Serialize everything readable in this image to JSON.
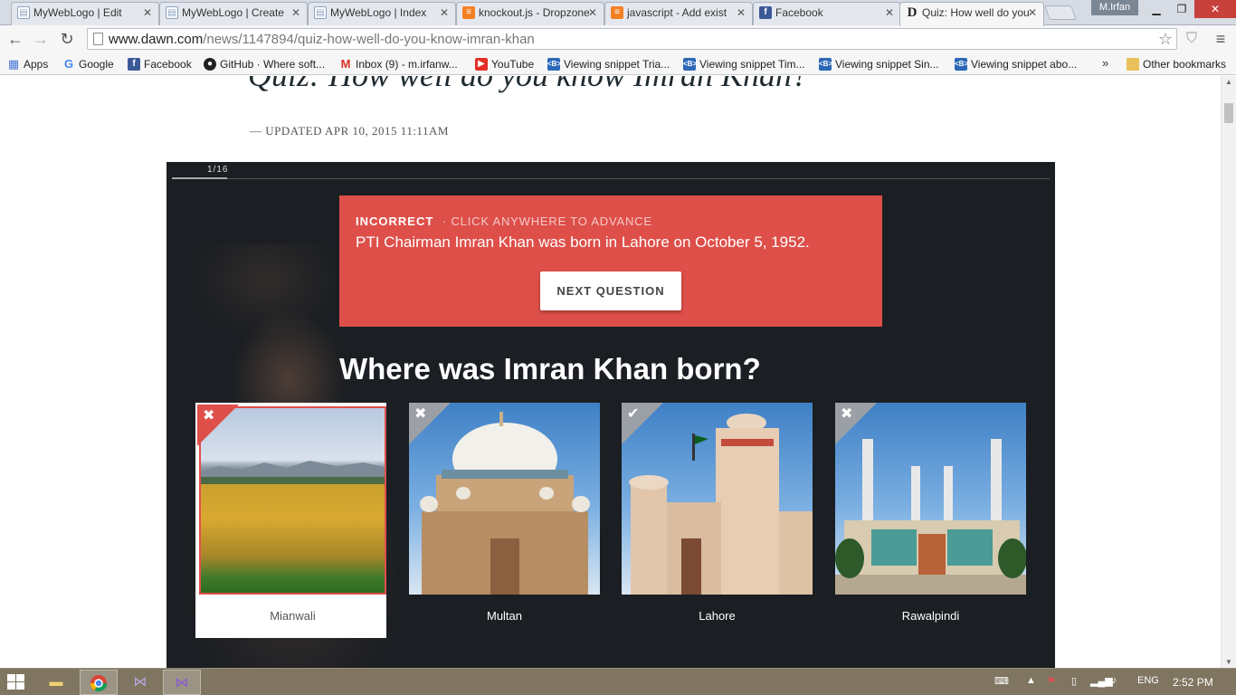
{
  "browser": {
    "tabs": [
      {
        "title": "MyWebLogo | Edit",
        "icon": "document-icon"
      },
      {
        "title": "MyWebLogo | Create",
        "icon": "document-icon"
      },
      {
        "title": "MyWebLogo | Index",
        "icon": "document-icon"
      },
      {
        "title": "knockout.js - Dropzone",
        "icon": "stackoverflow-icon"
      },
      {
        "title": "javascript - Add exist",
        "icon": "stackoverflow-icon"
      },
      {
        "title": "Facebook",
        "icon": "facebook-icon"
      },
      {
        "title": "Quiz: How well do you",
        "icon": "dawn-icon",
        "active": true
      }
    ],
    "profile_name": "M.Irfan",
    "url_host": "www.dawn.com",
    "url_path": "/news/1147894/quiz-how-well-do-you-know-imran-khan",
    "bookmarks": [
      {
        "label": "Apps",
        "icon": "apps-icon"
      },
      {
        "label": "Google",
        "icon": "google-icon"
      },
      {
        "label": "Facebook",
        "icon": "facebook-icon"
      },
      {
        "label": "GitHub · Where soft...",
        "icon": "github-icon"
      },
      {
        "label": "Inbox (9) - m.irfanw...",
        "icon": "gmail-icon"
      },
      {
        "label": "YouTube",
        "icon": "youtube-icon"
      },
      {
        "label": "Viewing snippet Tria...",
        "icon": "snippet-icon"
      },
      {
        "label": "Viewing snippet Tim...",
        "icon": "snippet-icon"
      },
      {
        "label": "Viewing snippet Sin...",
        "icon": "snippet-icon"
      },
      {
        "label": "Viewing snippet abo...",
        "icon": "snippet-icon"
      }
    ],
    "bookmarks_more": "»",
    "other_bookmarks": "Other bookmarks"
  },
  "article": {
    "title": "Quiz: How well do you know Imran Khan?",
    "updated": "— UPDATED APR 10, 2015 11:11AM"
  },
  "quiz": {
    "progress_label": "1/16",
    "progress_fraction": 0.0625,
    "feedback": {
      "status": "INCORRECT",
      "hint": "· CLICK ANYWHERE TO ADVANCE",
      "message": "PTI Chairman Imran Khan was born in Lahore on October 5, 1952.",
      "next_button": "NEXT QUESTION"
    },
    "question": "Where was Imran Khan born?",
    "options": [
      {
        "label": "Mianwali",
        "mark": "✖",
        "state": "selected-wrong"
      },
      {
        "label": "Multan",
        "mark": "✖",
        "state": "wrong"
      },
      {
        "label": "Lahore",
        "mark": "✔",
        "state": "correct"
      },
      {
        "label": "Rawalpindi",
        "mark": "✖",
        "state": "wrong"
      }
    ]
  },
  "taskbar": {
    "language": "ENG",
    "time": "2:52 PM"
  },
  "colors": {
    "accent_red": "#de4f4a",
    "quiz_background": "#1b1e22"
  }
}
